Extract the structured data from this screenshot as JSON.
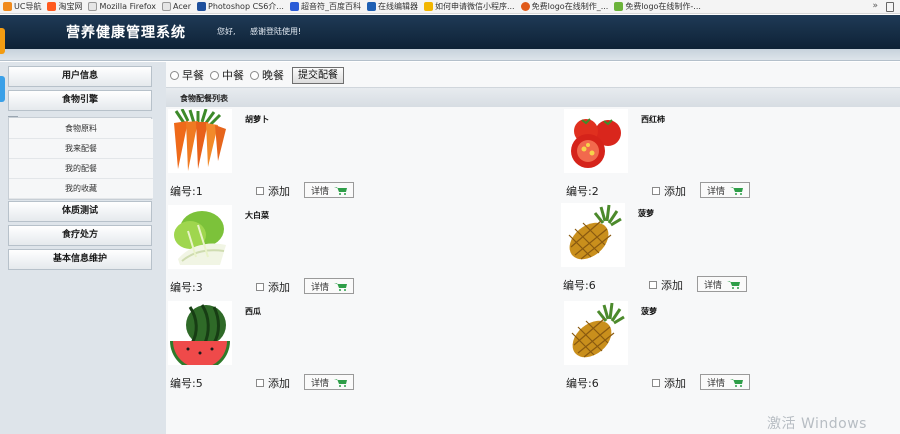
{
  "browser": {
    "bookmarks": [
      {
        "label": "UC导航",
        "color": "#f08a1c"
      },
      {
        "label": "淘宝网",
        "color": "#ff5a1f"
      },
      {
        "label": "Mozilla Firefox",
        "color": "#555555"
      },
      {
        "label": "Acer",
        "color": "#777777"
      },
      {
        "label": "Photoshop CS6介...",
        "color": "#1e4f9c"
      },
      {
        "label": "超音符_百度百科",
        "color": "#2a5bd7"
      },
      {
        "label": "在线编辑器",
        "color": "#1e5fb3"
      },
      {
        "label": "如何申请微信小程序...",
        "color": "#f2b600"
      },
      {
        "label": "免费logo在线制作_...",
        "color": "#e05a1a"
      },
      {
        "label": "免费logo在线制作-...",
        "color": "#6bb33a"
      }
    ],
    "overflow_glyph": "»"
  },
  "header": {
    "title": "营养健康管理系统",
    "greeting": "您好,",
    "message": "感谢登陆使用!"
  },
  "sidebar": {
    "sections": [
      {
        "label": "用户信息"
      },
      {
        "label": "食物引擎"
      },
      {
        "label": "体质测试"
      },
      {
        "label": "食疗处方"
      },
      {
        "label": "基本信息维护"
      }
    ],
    "sub_items": [
      {
        "label": "食物原料"
      },
      {
        "label": "我来配餐"
      },
      {
        "label": "我的配餐"
      },
      {
        "label": "我的收藏"
      }
    ]
  },
  "meal_selector": {
    "options": [
      {
        "label": "早餐",
        "checked": false
      },
      {
        "label": "中餐",
        "checked": false
      },
      {
        "label": "晚餐",
        "checked": false
      }
    ],
    "submit_label": "提交配餐"
  },
  "list": {
    "title": "食物配餐列表",
    "id_prefix": "编号:",
    "add_label": "添加",
    "detail_label": "详情",
    "foods": [
      {
        "name": "胡萝卜",
        "id": "1",
        "icon": "carrot-image"
      },
      {
        "name": "西红柿",
        "id": "2",
        "icon": "tomato-image"
      },
      {
        "name": "大白菜",
        "id": "3",
        "icon": "cabbage-image"
      },
      {
        "name": "菠萝",
        "id": "6",
        "icon": "pineapple-image"
      },
      {
        "name": "西瓜",
        "id": "5",
        "icon": "watermelon-image"
      },
      {
        "name": "菠萝",
        "id": "6",
        "icon": "pineapple-image"
      }
    ]
  },
  "watermark": "激活 Windows",
  "colors": {
    "header_bg": "#0e2236",
    "sidebar_bg": "#dee4ea",
    "cart_green": "#2e9e48"
  }
}
